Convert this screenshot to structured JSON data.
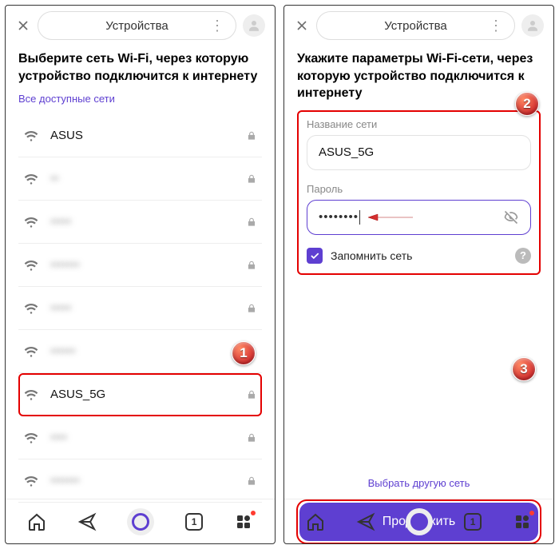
{
  "header": {
    "title": "Устройства"
  },
  "left": {
    "title": "Выберите сеть Wi-Fi, через которую устройство подключится к интернету",
    "subtitle": "Все доступные сети",
    "networks": [
      {
        "name": "ASUS",
        "blur": false,
        "highlight": false
      },
      {
        "name": "••",
        "blur": true,
        "highlight": false
      },
      {
        "name": "•••••",
        "blur": true,
        "highlight": false
      },
      {
        "name": "•••••••",
        "blur": true,
        "highlight": false
      },
      {
        "name": "•••••",
        "blur": true,
        "highlight": false
      },
      {
        "name": "••••••",
        "blur": true,
        "highlight": false
      },
      {
        "name": "ASUS_5G",
        "blur": false,
        "highlight": true
      },
      {
        "name": "••••",
        "blur": true,
        "highlight": false
      },
      {
        "name": "•••••••",
        "blur": true,
        "highlight": false
      }
    ]
  },
  "right": {
    "title": "Укажите параметры Wi-Fi-сети, через которую устройство подключится к интернету",
    "ssid_label": "Название сети",
    "ssid_value": "ASUS_5G",
    "pwd_label": "Пароль",
    "pwd_value": "••••••••",
    "remember_label": "Запомнить сеть",
    "continue_label": "Продолжить",
    "other_link": "Выбрать другую сеть"
  },
  "tabbar": {
    "tab_count": "1"
  },
  "badges": {
    "one": "1",
    "two": "2",
    "three": "3"
  }
}
